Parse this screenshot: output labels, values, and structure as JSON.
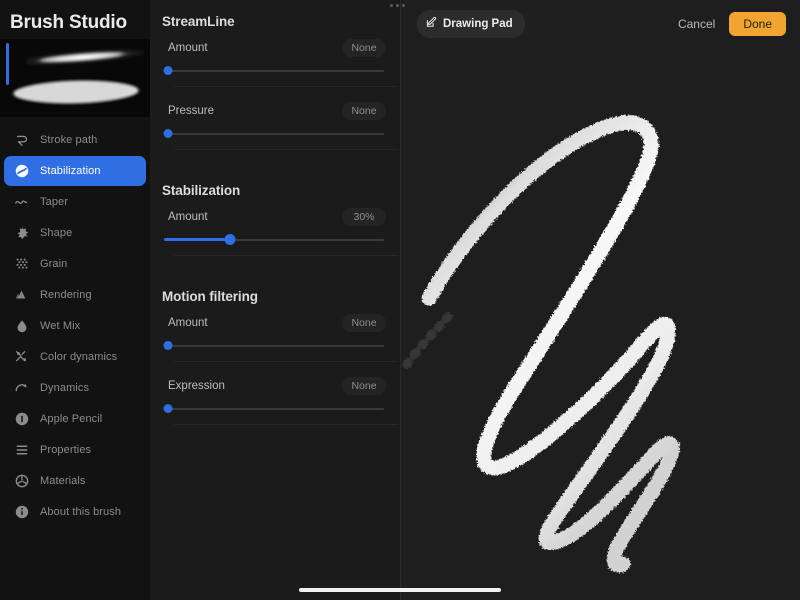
{
  "sidebar": {
    "title": "Brush Studio",
    "preview": {
      "accent_color": "#2f6fe3",
      "stroke_color": "#d8d8d8"
    },
    "items": [
      {
        "label": "Stroke path",
        "icon": "stroke-path-icon",
        "active": false
      },
      {
        "label": "Stabilization",
        "icon": "stabilization-icon",
        "active": true
      },
      {
        "label": "Taper",
        "icon": "taper-icon",
        "active": false
      },
      {
        "label": "Shape",
        "icon": "shape-icon",
        "active": false
      },
      {
        "label": "Grain",
        "icon": "grain-icon",
        "active": false
      },
      {
        "label": "Rendering",
        "icon": "rendering-icon",
        "active": false
      },
      {
        "label": "Wet Mix",
        "icon": "wet-mix-icon",
        "active": false
      },
      {
        "label": "Color dynamics",
        "icon": "color-dynamics-icon",
        "active": false
      },
      {
        "label": "Dynamics",
        "icon": "dynamics-icon",
        "active": false
      },
      {
        "label": "Apple Pencil",
        "icon": "apple-pencil-icon",
        "active": false
      },
      {
        "label": "Properties",
        "icon": "properties-icon",
        "active": false
      },
      {
        "label": "Materials",
        "icon": "materials-icon",
        "active": false
      },
      {
        "label": "About this brush",
        "icon": "info-icon",
        "active": false
      }
    ]
  },
  "settings": {
    "accent_color": "#2f6fe3",
    "sections": [
      {
        "title": "StreamLine",
        "rows": [
          {
            "label": "Amount",
            "value": "None",
            "percent": 0
          },
          {
            "label": "Pressure",
            "value": "None",
            "percent": 0
          }
        ]
      },
      {
        "title": "Stabilization",
        "rows": [
          {
            "label": "Amount",
            "value": "30%",
            "percent": 30
          }
        ]
      },
      {
        "title": "Motion filtering",
        "rows": [
          {
            "label": "Amount",
            "value": "None",
            "percent": 0
          },
          {
            "label": "Expression",
            "value": "None",
            "percent": 0
          }
        ]
      }
    ]
  },
  "canvas": {
    "pad_label": "Drawing Pad",
    "pad_icon": "pencil-square-icon",
    "cancel_label": "Cancel",
    "done_label": "Done",
    "done_color": "#f0a431",
    "background_color": "#1e1e1e",
    "stroke_color": "#ffffff",
    "window_menu_icon": "three-dots-icon"
  }
}
